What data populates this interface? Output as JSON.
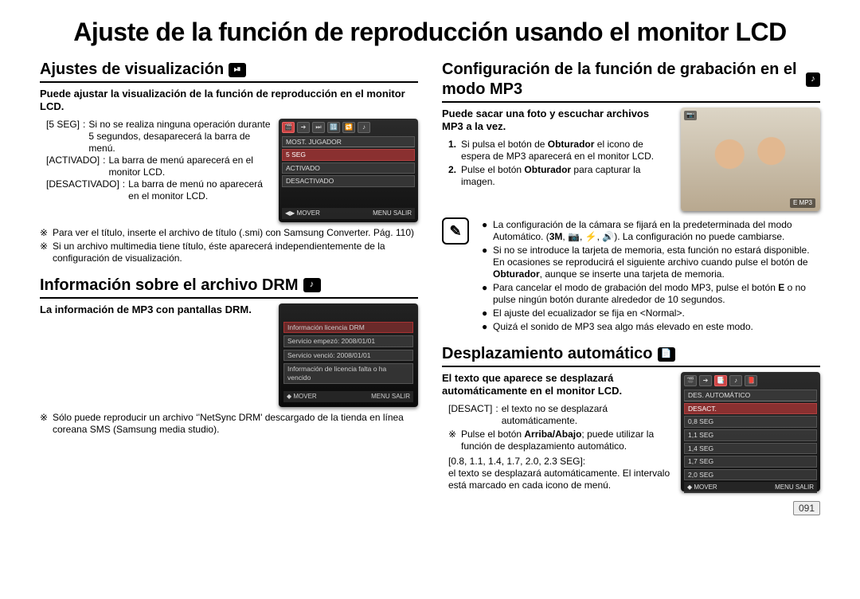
{
  "page_title": "Ajuste de la función de reproducción usando el monitor LCD",
  "page_number": "091",
  "left": {
    "sec1": {
      "heading": "Ajustes de visualización",
      "icon": "⏯",
      "intro": "Puede ajustar la visualización de la función de reproducción en el monitor LCD.",
      "defs": [
        {
          "term": "[5 SEG]",
          "sep": ":",
          "body": "Si no se realiza ninguna operación durante 5 segundos, desaparecerá la barra de menú."
        },
        {
          "term": "[ACTIVADO]",
          "sep": ":",
          "body": "La barra de menú aparecerá en el monitor LCD."
        },
        {
          "term": "[DESACTIVADO]",
          "sep": ":",
          "body": "La barra de menú no aparecerá en el monitor LCD."
        }
      ],
      "screen": {
        "top_icons": [
          "🎬",
          "➔",
          "⏭",
          "🔢",
          "🔁",
          "♪"
        ],
        "label_top": "MOST. JUGADOR",
        "rows": [
          "5 SEG",
          "ACTIVADO",
          "DESACTIVADO"
        ],
        "footer_left": "◀▶ MOVER",
        "footer_right": "MENU SALIR"
      },
      "notes": [
        "Para ver el título, inserte el archivo de título (.smi) con Samsung Converter.  Pág. 110)",
        "Si un archivo multimedia tiene título, éste aparecerá independientemente de la configuración de visualización."
      ]
    },
    "sec2": {
      "heading": "Información sobre el archivo DRM",
      "icon": "♪",
      "intro": "La información de MP3 con pantallas DRM.",
      "screen": {
        "rows": [
          "Información licencia DRM",
          "Servicio empezó: 2008/01/01",
          "Servicio venció: 2008/01/01",
          "Información de licencia falta o ha vencido"
        ],
        "footer_left": "◆ MOVER",
        "footer_right": "MENU SALIR"
      },
      "notes": [
        "Sólo puede reproducir un archivo ‘'NetSync DRM' descargado de la tienda en línea coreana SMS (Samsung media studio)."
      ]
    }
  },
  "right": {
    "sec1": {
      "heading": "Configuración de la función de grabación en el modo MP3",
      "icon": "♪",
      "intro": "Puede sacar una foto y escuchar archivos MP3 a la vez.",
      "steps": [
        {
          "n": "1.",
          "b": "Si pulsa el botón de <b>Obturador</b> el icono de espera de MP3 aparecerá en el monitor LCD."
        },
        {
          "n": "2.",
          "b": "Pulse el botón <b>Obturador</b> para capturar la imagen."
        }
      ],
      "photo": {
        "top": "📷",
        "bot": "E  MP3"
      },
      "notebox": {
        "icon": "✎",
        "bullets": [
          "La configuración de la cámara se fijará en la predeterminada del modo Automático. (<b>3M</b>, 📷, ⚡, 🔊). La configuración no puede cambiarse.",
          "Si no se introduce la tarjeta de memoria, esta función no estará disponible. En ocasiones se reproducirá el siguiente archivo cuando pulse el botón de <b>Obturador</b>, aunque se inserte una tarjeta de memoria.",
          "Para cancelar el modo de grabación del modo MP3, pulse el botón <b>E</b> o no pulse ningún botón durante alrededor de 10 segundos.",
          "El ajuste del ecualizador se fija en &lt;Normal&gt;.",
          "Quizá el sonido de MP3 sea algo más elevado en este modo."
        ]
      }
    },
    "sec2": {
      "heading": "Desplazamiento automático",
      "icon": "📄",
      "intro": "El texto que aparece se desplazará automáticamente en el monitor LCD.",
      "defs": [
        {
          "term": "[DESACT]",
          "sep": ":",
          "body": "el texto no se desplazará automáticamente."
        }
      ],
      "note_defs": "Pulse el botón <b>Arriba/Abajo</b>; puede utilizar la función de desplazamiento automático.",
      "defs2": {
        "term": "[0.8, 1.1, 1.4, 1.7, 2.0, 2.3 SEG]",
        "sep": ":",
        "body": "el texto se desplazará automáticamente. El intervalo está marcado en cada icono de menú."
      },
      "screen": {
        "top_icons": [
          "🎬",
          "➔",
          "📑",
          "♪",
          "📕"
        ],
        "label_top": "DES. AUTOMÁTICO",
        "rows": [
          "DESACT.",
          "0,8 SEG",
          "1,1 SEG",
          "1,4 SEG",
          "1,7 SEG",
          "2,0 SEG"
        ],
        "footer_left": "◆ MOVER",
        "footer_right": "MENU SALIR"
      }
    }
  }
}
